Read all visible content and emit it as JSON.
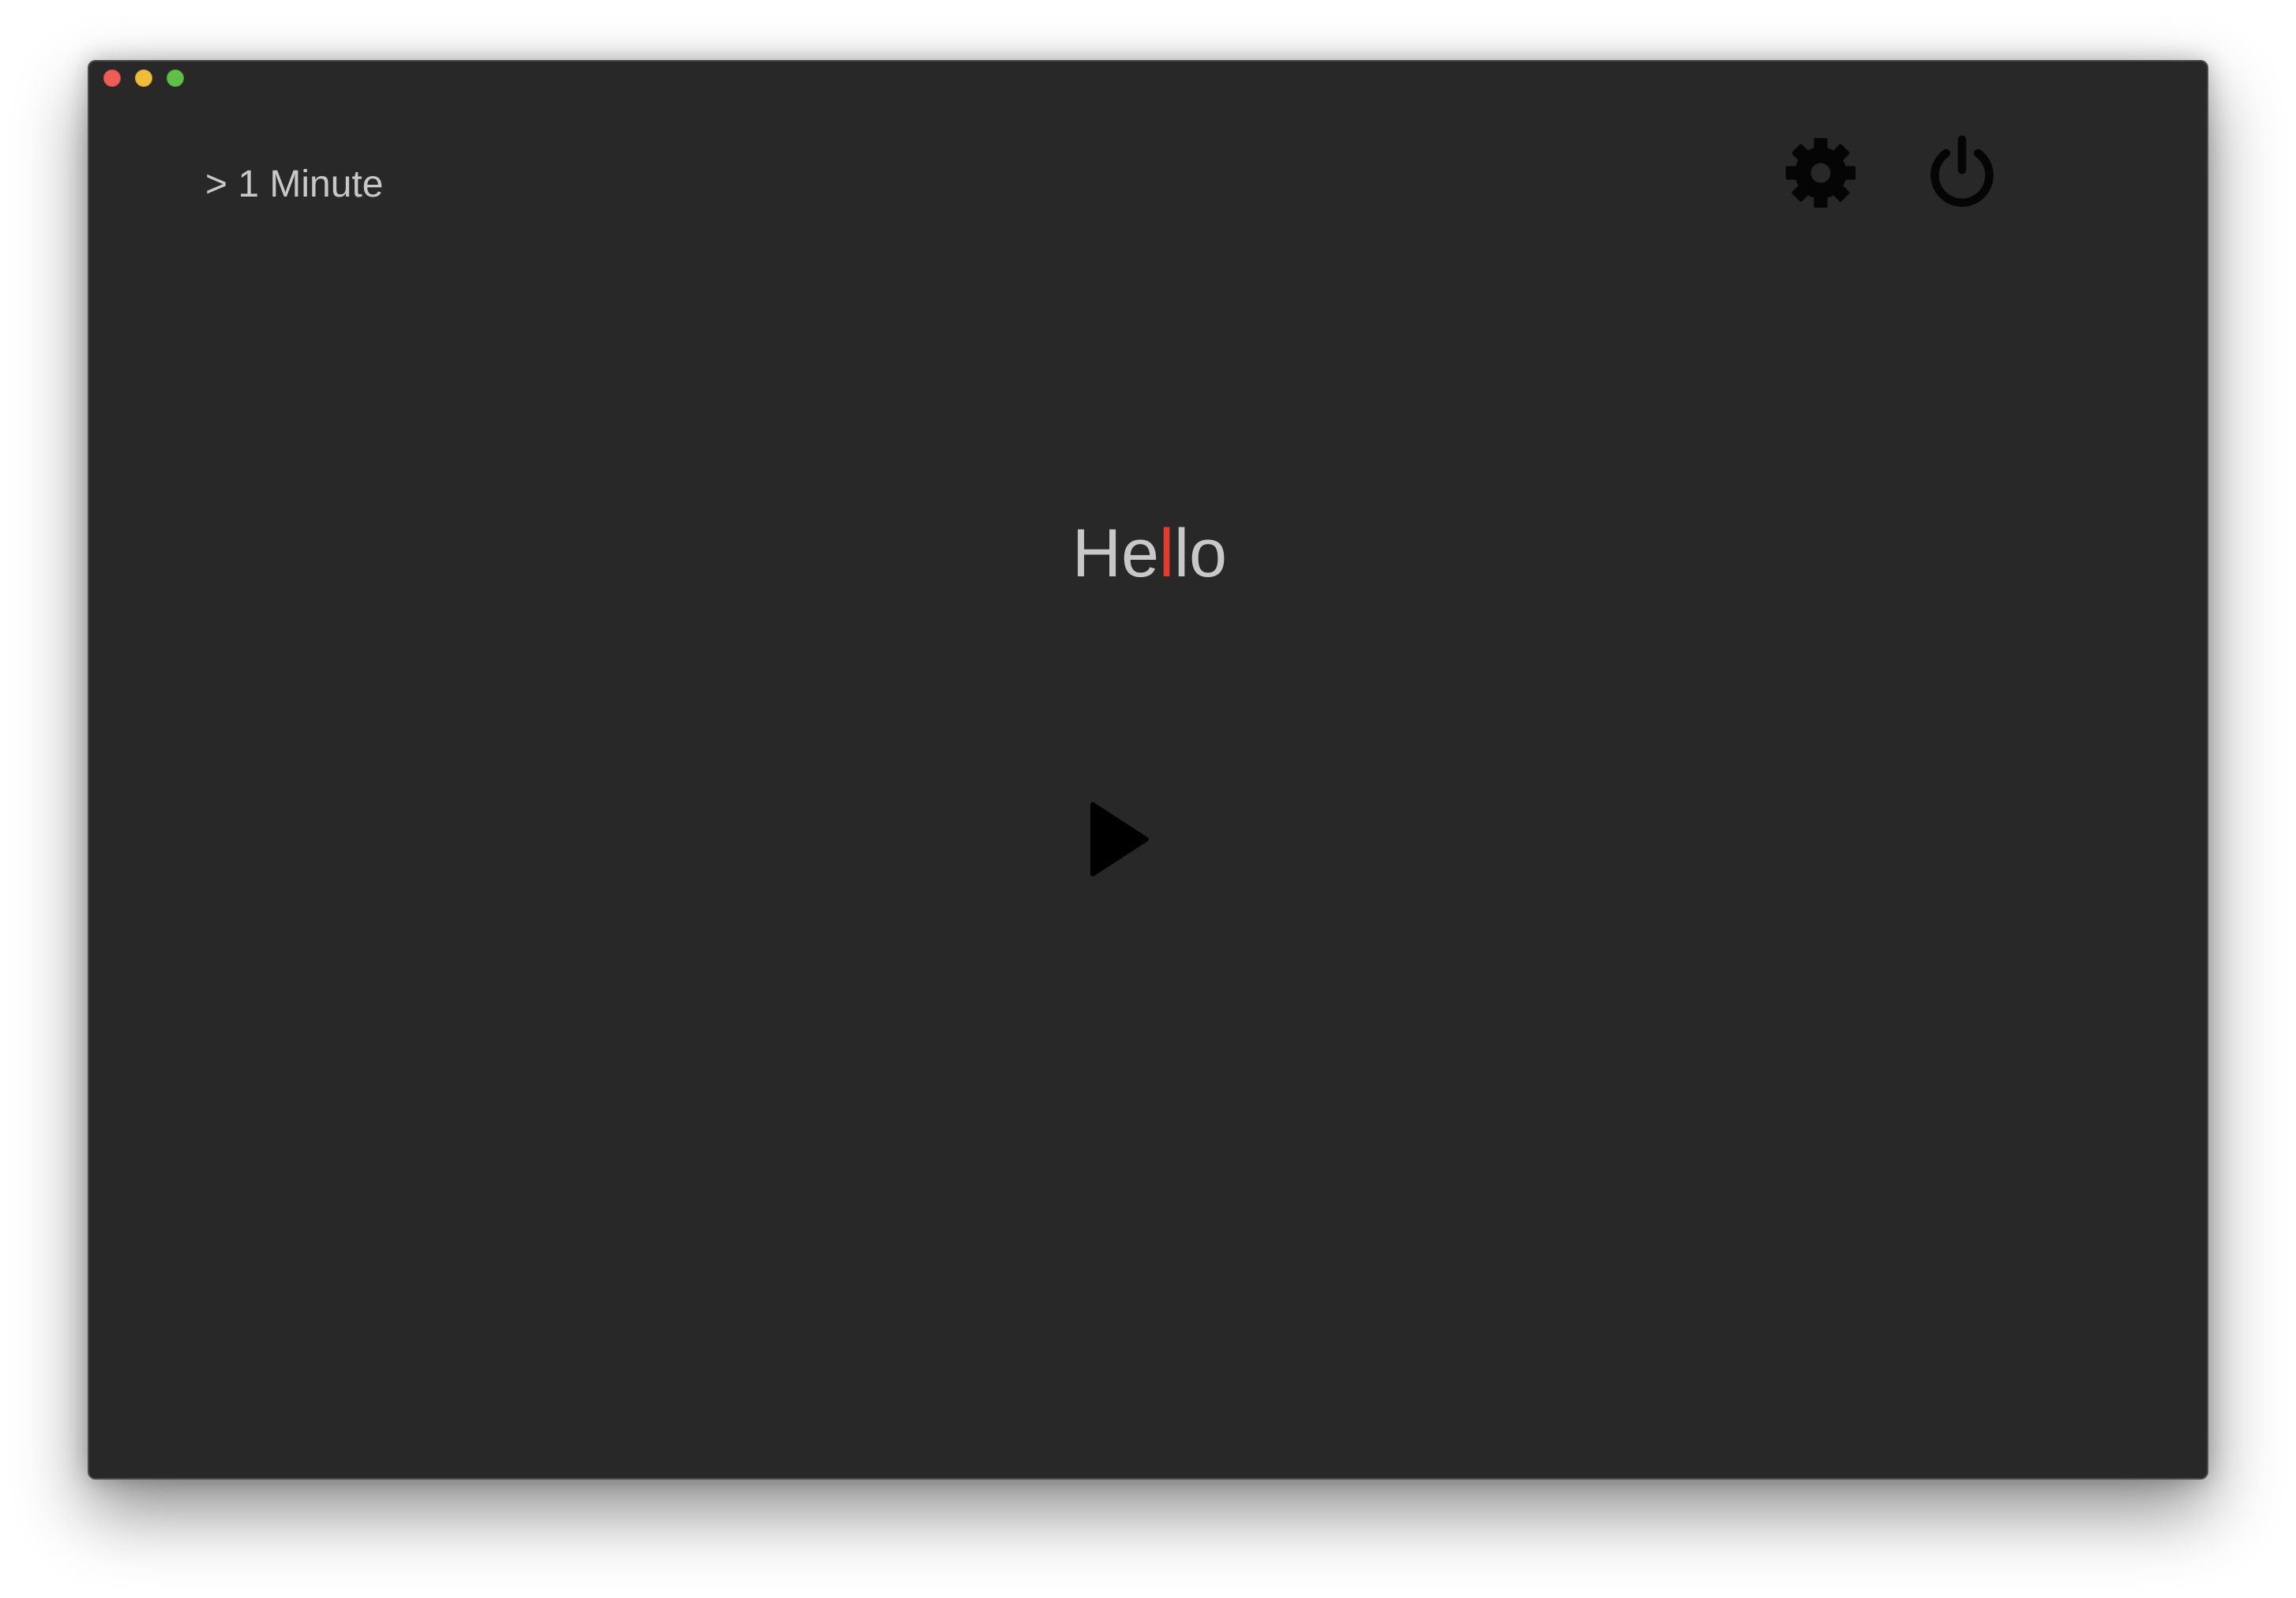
{
  "window": {
    "controls": {
      "close_color": "#ee5e57",
      "minimize_color": "#f0be36",
      "maximize_color": "#5ec045"
    }
  },
  "header": {
    "timer_label": "> 1 Minute",
    "settings_icon": "gear-icon",
    "power_icon": "power-icon"
  },
  "reader": {
    "word_before": "He",
    "word_focus": "l",
    "word_after": "lo",
    "focus_color": "#e8392c"
  },
  "controls": {
    "play_icon": "play-icon"
  }
}
